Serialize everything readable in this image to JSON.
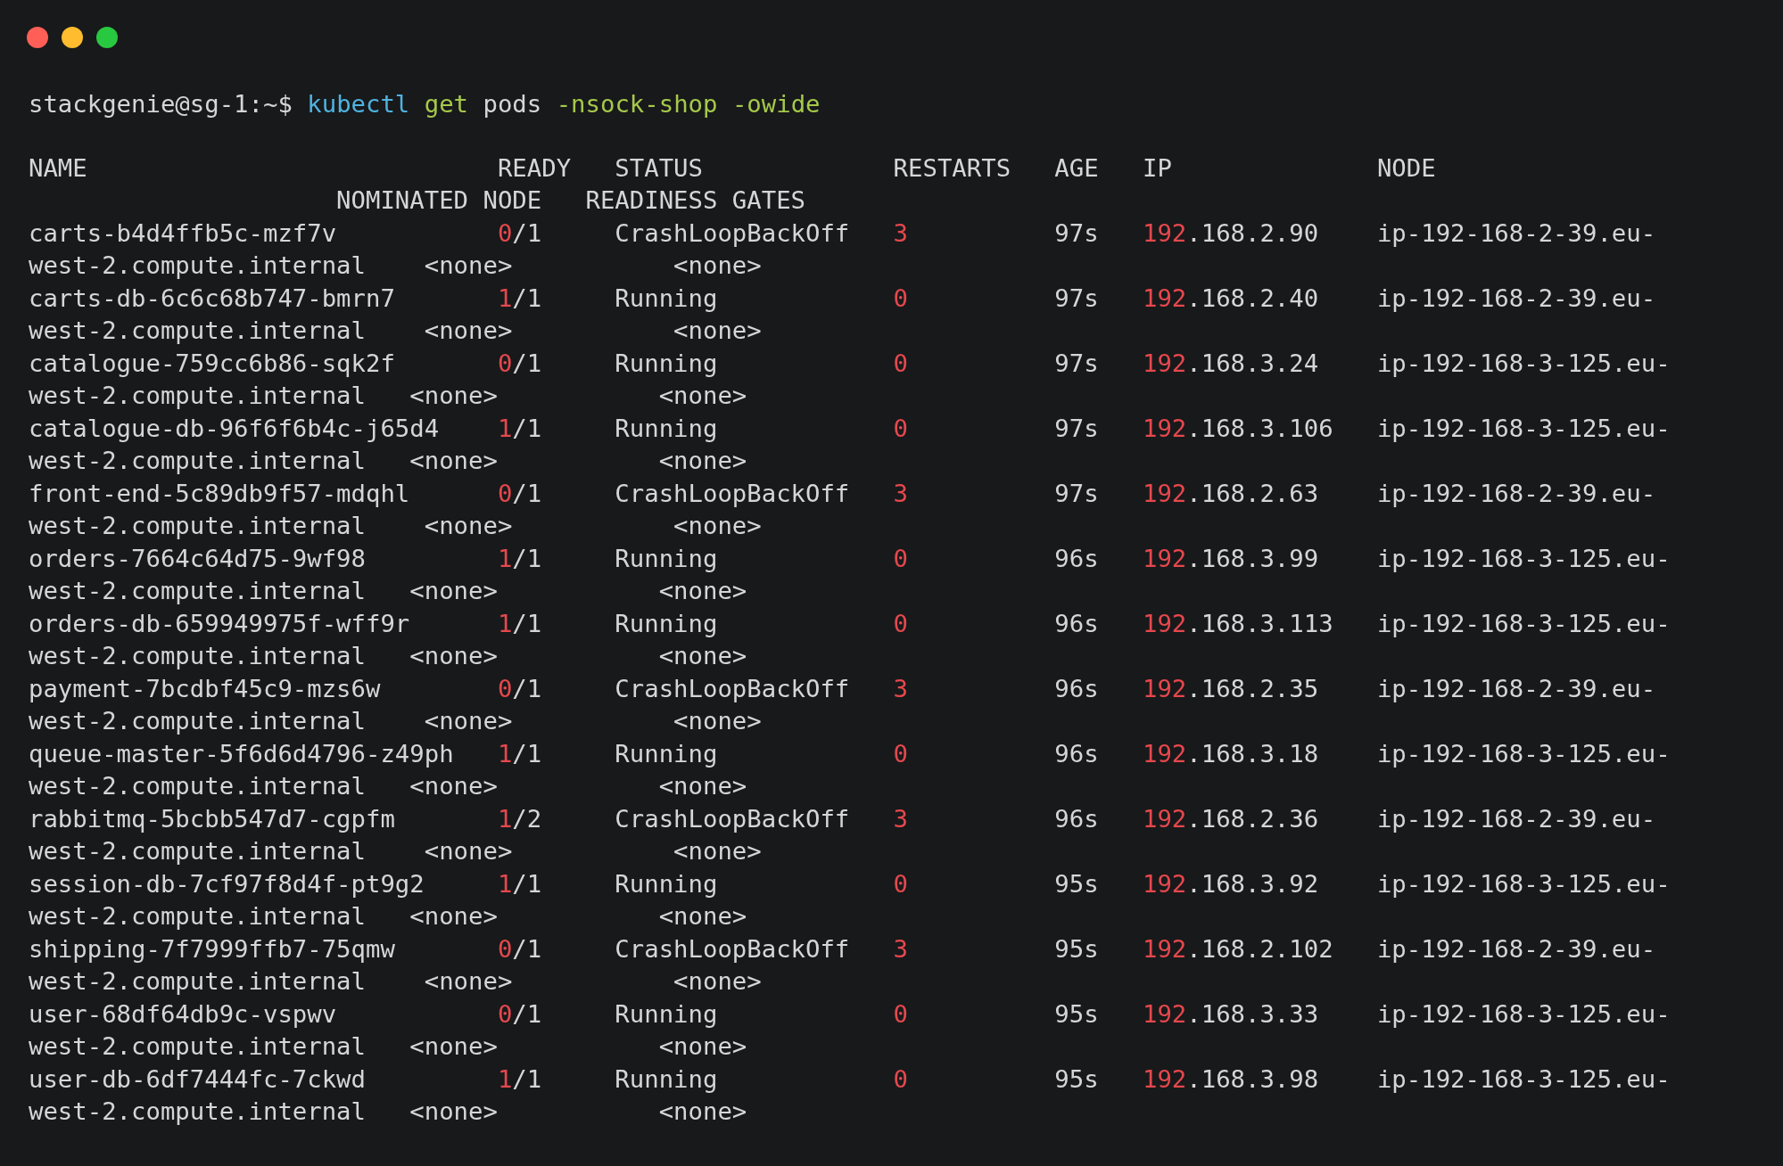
{
  "window": {
    "controls": [
      {
        "color": "#ff5f57"
      },
      {
        "color": "#febc2e"
      },
      {
        "color": "#28c840"
      }
    ]
  },
  "prompt": "stackgenie@sg-1:~$",
  "command": [
    {
      "text": "kubectl",
      "kind": "program"
    },
    {
      "text": "get",
      "kind": "verb"
    },
    {
      "text": "pods",
      "kind": "arg"
    },
    {
      "text": "-nsock-shop",
      "kind": "flag"
    },
    {
      "text": "-owide",
      "kind": "flag"
    }
  ],
  "header": {
    "line_1": [
      "NAME",
      "READY",
      "STATUS",
      "RESTARTS",
      "AGE",
      "IP",
      "NODE"
    ],
    "line_2": [
      "NOMINATED NODE",
      "READINESS GATES"
    ]
  },
  "pods": [
    {
      "name": "carts-b4d4ffb5c-mzf7v",
      "ready": "0/1",
      "status": "CrashLoopBackOff",
      "restarts": "3",
      "age": "97s",
      "ip": "192.168.2.90",
      "node": "ip-192-168-2-39.eu-",
      "node_continued": "west-2.compute.internal",
      "nominated_node": "<none>",
      "readiness_gates": "<none>"
    },
    {
      "name": "carts-db-6c6c68b747-bmrn7",
      "ready": "1/1",
      "status": "Running",
      "restarts": "0",
      "age": "97s",
      "ip": "192.168.2.40",
      "node": "ip-192-168-2-39.eu-",
      "node_continued": "west-2.compute.internal",
      "nominated_node": "<none>",
      "readiness_gates": "<none>"
    },
    {
      "name": "catalogue-759cc6b86-sqk2f",
      "ready": "0/1",
      "status": "Running",
      "restarts": "0",
      "age": "97s",
      "ip": "192.168.3.24",
      "node": "ip-192-168-3-125.eu-",
      "node_continued": "west-2.compute.internal",
      "nominated_node": "<none>",
      "readiness_gates": "<none>"
    },
    {
      "name": "catalogue-db-96f6f6b4c-j65d4",
      "ready": "1/1",
      "status": "Running",
      "restarts": "0",
      "age": "97s",
      "ip": "192.168.3.106",
      "node": "ip-192-168-3-125.eu-",
      "node_continued": "west-2.compute.internal",
      "nominated_node": "<none>",
      "readiness_gates": "<none>"
    },
    {
      "name": "front-end-5c89db9f57-mdqhl",
      "ready": "0/1",
      "status": "CrashLoopBackOff",
      "restarts": "3",
      "age": "97s",
      "ip": "192.168.2.63",
      "node": "ip-192-168-2-39.eu-",
      "node_continued": "west-2.compute.internal",
      "nominated_node": "<none>",
      "readiness_gates": "<none>"
    },
    {
      "name": "orders-7664c64d75-9wf98",
      "ready": "1/1",
      "status": "Running",
      "restarts": "0",
      "age": "96s",
      "ip": "192.168.3.99",
      "node": "ip-192-168-3-125.eu-",
      "node_continued": "west-2.compute.internal",
      "nominated_node": "<none>",
      "readiness_gates": "<none>"
    },
    {
      "name": "orders-db-659949975f-wff9r",
      "ready": "1/1",
      "status": "Running",
      "restarts": "0",
      "age": "96s",
      "ip": "192.168.3.113",
      "node": "ip-192-168-3-125.eu-",
      "node_continued": "west-2.compute.internal",
      "nominated_node": "<none>",
      "readiness_gates": "<none>"
    },
    {
      "name": "payment-7bcdbf45c9-mzs6w",
      "ready": "0/1",
      "status": "CrashLoopBackOff",
      "restarts": "3",
      "age": "96s",
      "ip": "192.168.2.35",
      "node": "ip-192-168-2-39.eu-",
      "node_continued": "west-2.compute.internal",
      "nominated_node": "<none>",
      "readiness_gates": "<none>"
    },
    {
      "name": "queue-master-5f6d6d4796-z49ph",
      "ready": "1/1",
      "status": "Running",
      "restarts": "0",
      "age": "96s",
      "ip": "192.168.3.18",
      "node": "ip-192-168-3-125.eu-",
      "node_continued": "west-2.compute.internal",
      "nominated_node": "<none>",
      "readiness_gates": "<none>"
    },
    {
      "name": "rabbitmq-5bcbb547d7-cgpfm",
      "ready": "1/2",
      "status": "CrashLoopBackOff",
      "restarts": "3",
      "age": "96s",
      "ip": "192.168.2.36",
      "node": "ip-192-168-2-39.eu-",
      "node_continued": "west-2.compute.internal",
      "nominated_node": "<none>",
      "readiness_gates": "<none>"
    },
    {
      "name": "session-db-7cf97f8d4f-pt9g2",
      "ready": "1/1",
      "status": "Running",
      "restarts": "0",
      "age": "95s",
      "ip": "192.168.3.92",
      "node": "ip-192-168-3-125.eu-",
      "node_continued": "west-2.compute.internal",
      "nominated_node": "<none>",
      "readiness_gates": "<none>"
    },
    {
      "name": "shipping-7f7999ffb7-75qmw",
      "ready": "0/1",
      "status": "CrashLoopBackOff",
      "restarts": "3",
      "age": "95s",
      "ip": "192.168.2.102",
      "node": "ip-192-168-2-39.eu-",
      "node_continued": "west-2.compute.internal",
      "nominated_node": "<none>",
      "readiness_gates": "<none>"
    },
    {
      "name": "user-68df64db9c-vspwv",
      "ready": "0/1",
      "status": "Running",
      "restarts": "0",
      "age": "95s",
      "ip": "192.168.3.33",
      "node": "ip-192-168-3-125.eu-",
      "node_continued": "west-2.compute.internal",
      "nominated_node": "<none>",
      "readiness_gates": "<none>"
    },
    {
      "name": "user-db-6df7444fc-7ckwd",
      "ready": "1/1",
      "status": "Running",
      "restarts": "0",
      "age": "95s",
      "ip": "192.168.3.98",
      "node": "ip-192-168-3-125.eu-",
      "node_continued": "west-2.compute.internal",
      "nominated_node": "<none>",
      "readiness_gates": "<none>"
    }
  ]
}
